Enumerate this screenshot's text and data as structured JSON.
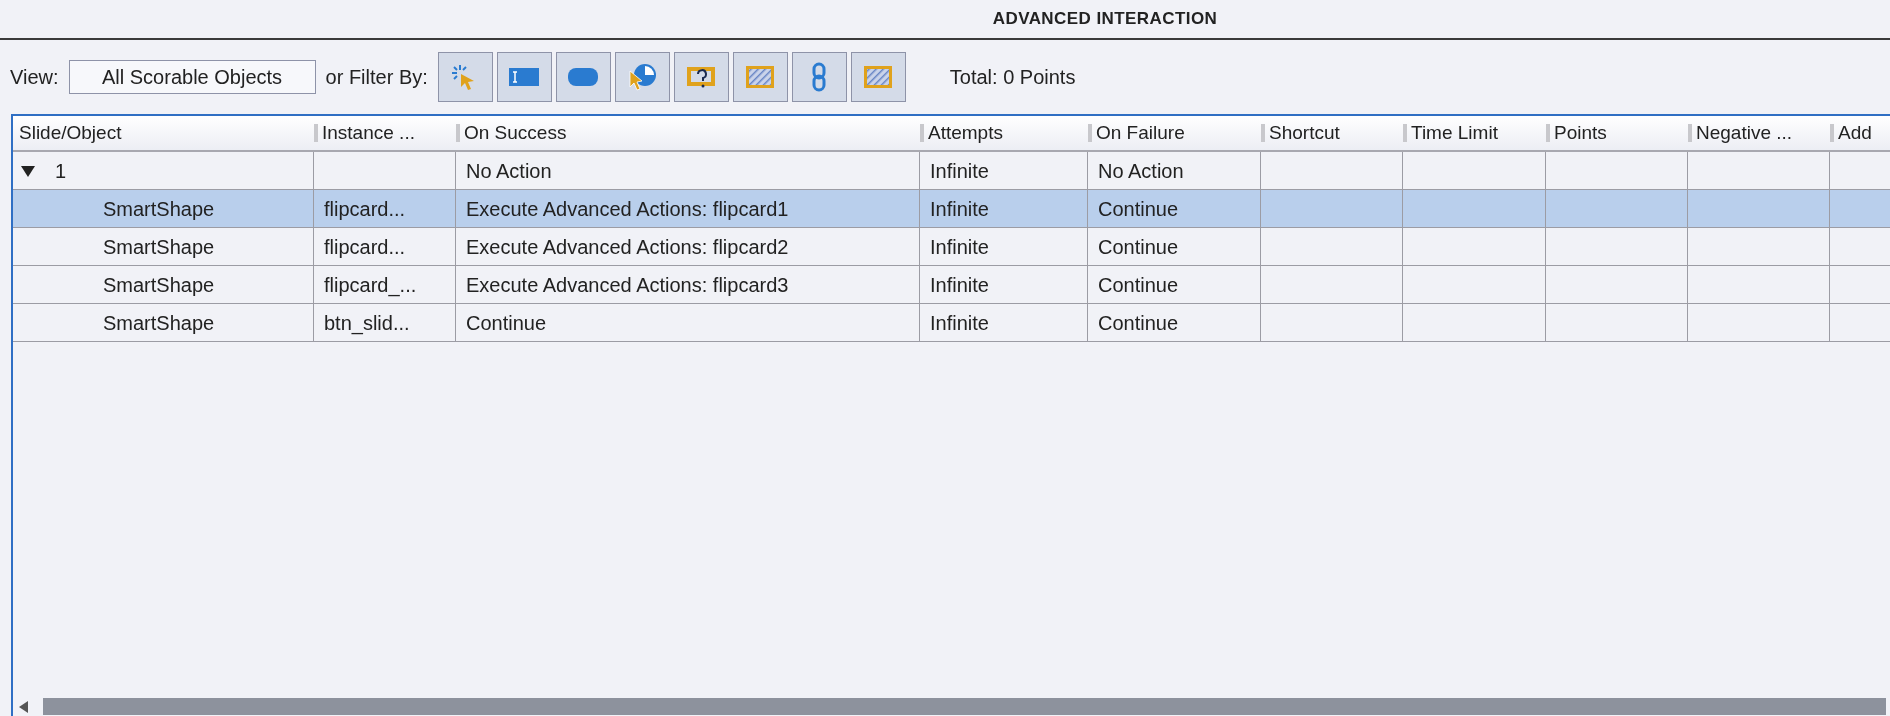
{
  "title": "ADVANCED INTERACTION",
  "toolbar": {
    "view_label": "View:",
    "view_value": "All Scorable Objects",
    "filter_label": "or Filter By:",
    "total": "Total: 0 Points"
  },
  "table": {
    "columns": [
      "Slide/Object",
      "Instance ...",
      "On Success",
      "Attempts",
      "On Failure",
      "Shortcut",
      "Time Limit",
      "Points",
      "Negative ...",
      "Add"
    ],
    "rows": [
      {
        "cells": [
          "1",
          "",
          "No Action",
          "Infinite",
          "No Action",
          "",
          "",
          "",
          "",
          ""
        ],
        "expanded": true,
        "selected": false,
        "children": [
          {
            "cells": [
              "SmartShape",
              "flipcard...",
              "Execute Advanced Actions: flipcard1",
              "Infinite",
              "Continue",
              "",
              "",
              "",
              "",
              ""
            ],
            "selected": true
          },
          {
            "cells": [
              "SmartShape",
              "flipcard...",
              "Execute Advanced Actions: flipcard2",
              "Infinite",
              "Continue",
              "",
              "",
              "",
              "",
              ""
            ],
            "selected": false
          },
          {
            "cells": [
              "SmartShape",
              "flipcard_...",
              "Execute Advanced Actions: flipcard3",
              "Infinite",
              "Continue",
              "",
              "",
              "",
              "",
              ""
            ],
            "selected": false
          },
          {
            "cells": [
              "SmartShape",
              "btn_slid...",
              "Continue",
              "Infinite",
              "Continue",
              "",
              "",
              "",
              "",
              ""
            ],
            "selected": false
          }
        ]
      }
    ]
  }
}
